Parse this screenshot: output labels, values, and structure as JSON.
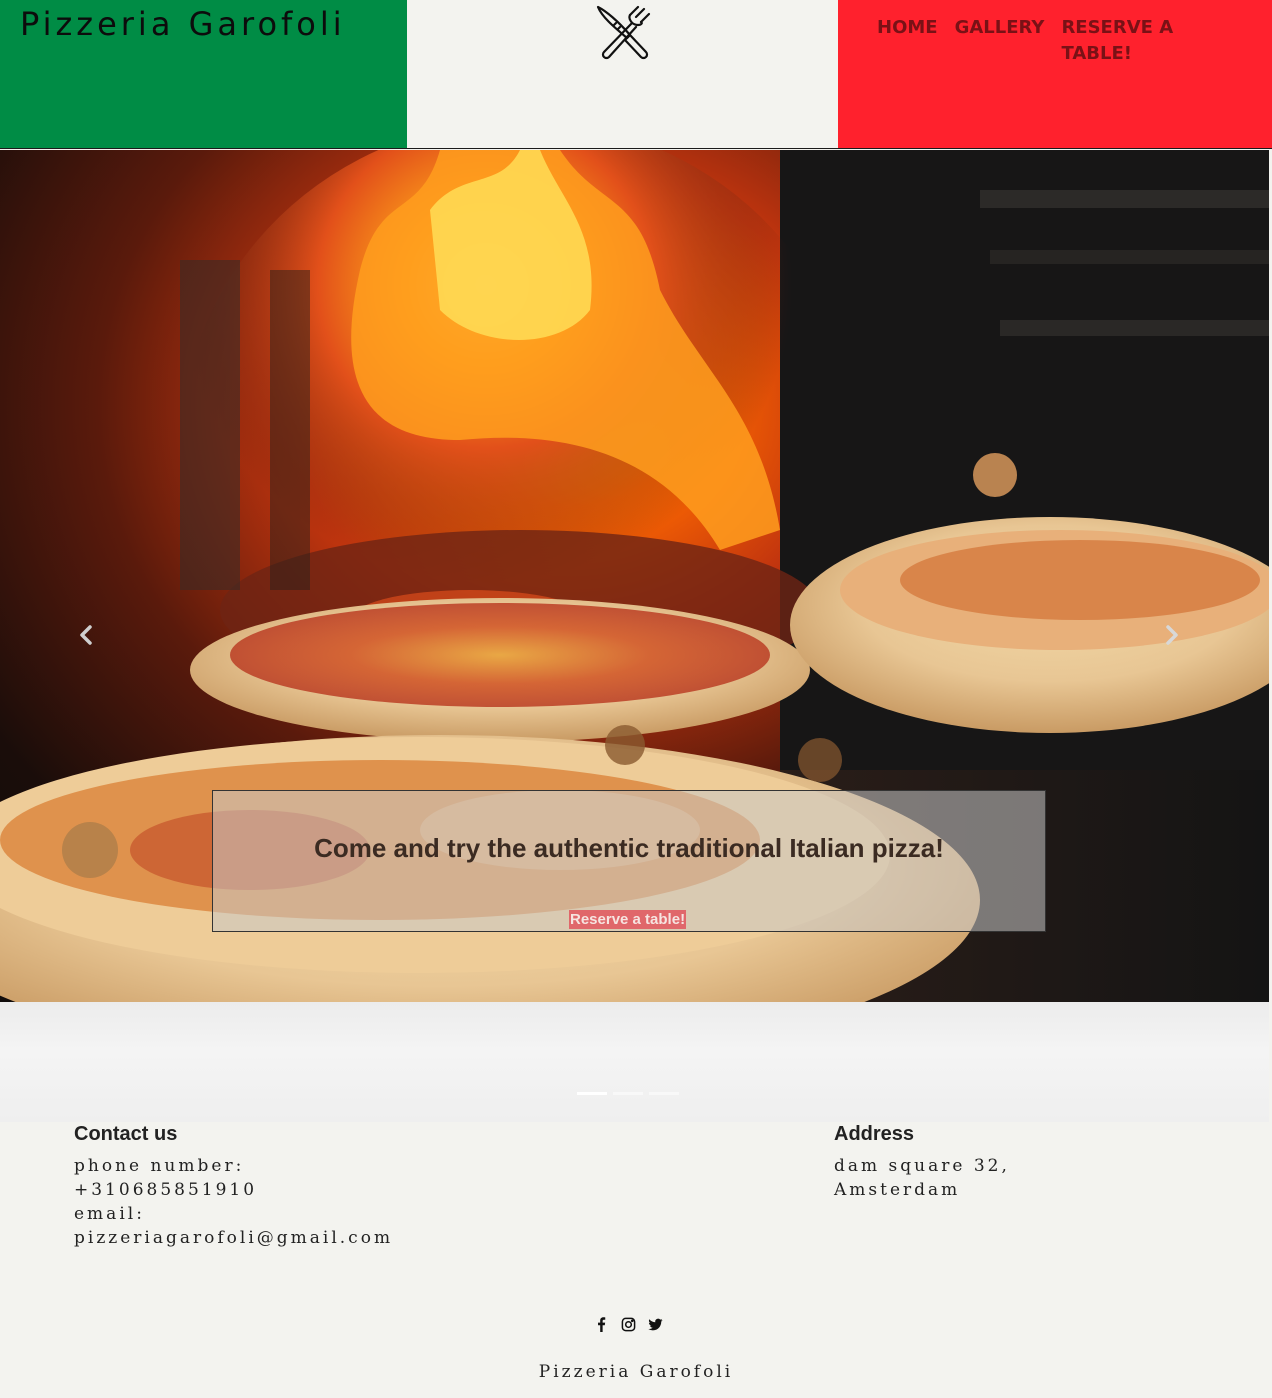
{
  "header": {
    "brand": "Pizzeria Garofoli",
    "logo_icon": "fork-knife-crossed-icon",
    "nav": [
      {
        "label": "HOME"
      },
      {
        "label": "GALLERY"
      },
      {
        "label": "RESERVE A TABLE!"
      }
    ],
    "colors": {
      "green": "#008c45",
      "white": "#f3f3ef",
      "red": "#ff212d",
      "nav_text": "#7a1116"
    }
  },
  "hero": {
    "image_icon": "wood-fired-oven-pizza-photo",
    "prev_icon": "chevron-left-icon",
    "next_icon": "chevron-right-icon",
    "caption": "Come and try the authentic traditional Italian pizza!",
    "cta_label": "Reserve a table!",
    "slides": 3,
    "active_slide": 1
  },
  "contact": {
    "heading": "Contact us",
    "phone_label": "phone number:",
    "phone": "+310685851910",
    "email_label": "email:",
    "email": "pizzeriagarofoli@gmail.com"
  },
  "address": {
    "heading": "Address",
    "line1": "dam square 32,",
    "line2": "Amsterdam"
  },
  "social": [
    {
      "icon": "facebook-icon"
    },
    {
      "icon": "instagram-icon"
    },
    {
      "icon": "twitter-icon"
    }
  ],
  "footer": {
    "name": "Pizzeria Garofoli"
  }
}
